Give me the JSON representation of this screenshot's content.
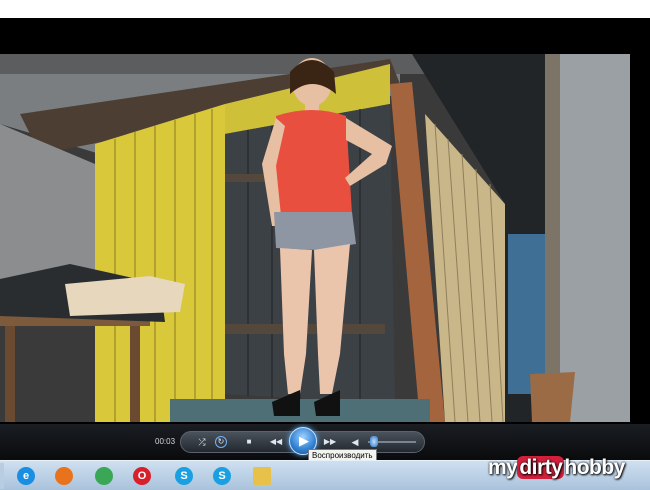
{
  "player": {
    "elapsed_time": "00:03",
    "play_tooltip": "Воспроизводить",
    "volume_level": 0.05,
    "controls": {
      "shuffle_icon": "shuffle-icon",
      "repeat_icon": "repeat-icon",
      "stop_icon": "stop-icon",
      "previous_icon": "previous-icon",
      "play_icon": "play-icon",
      "next_icon": "next-icon",
      "mute_icon": "speaker-icon"
    }
  },
  "taskbar": {
    "items": [
      {
        "name": "internet-explorer",
        "glyph": "e",
        "color": "#1a8ee0"
      },
      {
        "name": "firefox",
        "glyph": "",
        "color": "#e8731c"
      },
      {
        "name": "chrome",
        "glyph": "",
        "color": "#3aa757"
      },
      {
        "name": "opera",
        "glyph": "O",
        "color": "#d8202d"
      },
      {
        "name": "skype",
        "glyph": "S",
        "color": "#1aa0e0"
      },
      {
        "name": "skype-2",
        "glyph": "S",
        "color": "#1aa0e0"
      },
      {
        "name": "file-explorer",
        "glyph": "",
        "color": "#e8c14a"
      }
    ]
  },
  "watermark": {
    "prefix": "my",
    "highlight": "dirty",
    "suffix": "hobby"
  },
  "colors": {
    "accent": "#2f7fd0",
    "watermark_red": "#d21f3c"
  }
}
